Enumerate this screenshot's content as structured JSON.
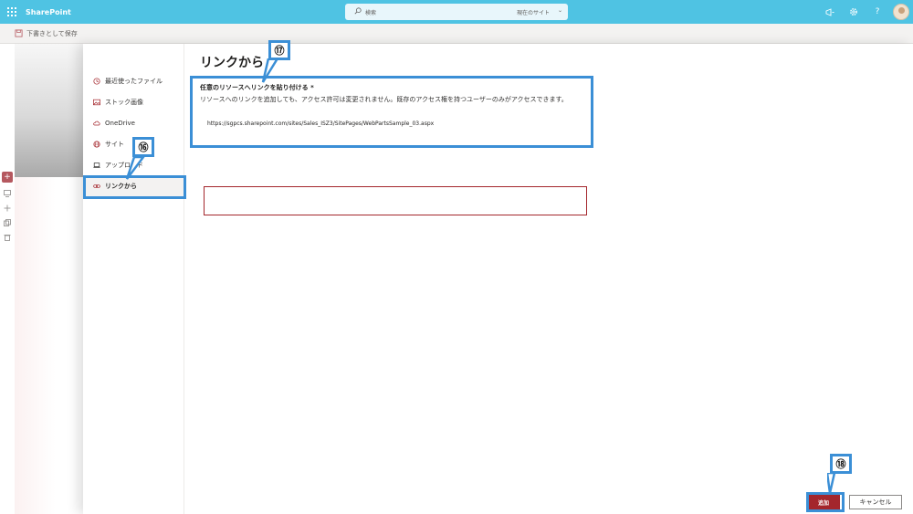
{
  "app": {
    "name": "SharePoint",
    "search_placeholder": "検索",
    "search_scope": "現在のサイト",
    "help_label": "?"
  },
  "cmdbar": {
    "save_draft": "下書きとして保存"
  },
  "rail": {
    "add_label": "+"
  },
  "nav": {
    "items": [
      {
        "label": "最近使ったファイル",
        "icon": "clock-icon"
      },
      {
        "label": "ストック画像",
        "icon": "image-icon"
      },
      {
        "label": "OneDrive",
        "icon": "cloud-icon"
      },
      {
        "label": "サイト",
        "icon": "globe-icon"
      },
      {
        "label": "アップロード",
        "icon": "laptop-icon"
      },
      {
        "label": "リンクから",
        "icon": "link-icon",
        "selected": true
      }
    ]
  },
  "content": {
    "title": "リンクから",
    "field_label": "任意のリソースへリンクを貼り付ける *",
    "field_desc": "リソースへのリンクを追加しても、アクセス許可は変更されません。既存のアクセス権を持つユーザーのみがアクセスできます。",
    "link_value": "https://sgpcs.sharepoint.com/sites/Sales_ISZ3/SitePages/WebPartsSample_03.aspx"
  },
  "buttons": {
    "add": "追加",
    "cancel": "キャンセル"
  },
  "annotations": {
    "callout_16": "⑯",
    "callout_17": "⑰",
    "callout_18": "⑱",
    "highlight_color": "#3b8fd6"
  },
  "colors": {
    "suitebar": "#4fc3e3",
    "accent_red": "#a4262c"
  }
}
